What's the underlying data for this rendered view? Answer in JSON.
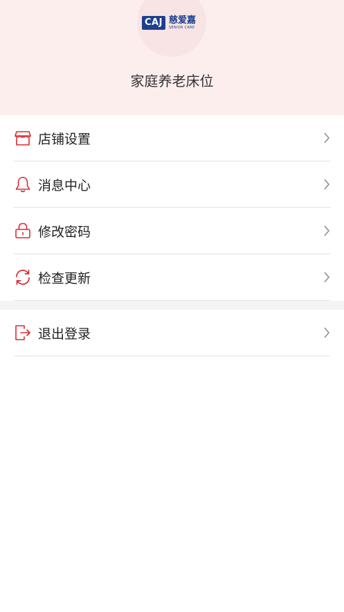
{
  "brand": {
    "logo_abbrev": "CAJ",
    "logo_name_cn": "慈爱嘉",
    "logo_name_en": "SENIOR CARE"
  },
  "store_name": "家庭养老床位",
  "colors": {
    "header_bg": "#fdeeee",
    "icon_red": "#e0282e",
    "logo_blue": "#1d3f8f",
    "divider": "#e2e2e2"
  },
  "menu": [
    {
      "label": "店铺设置",
      "icon": "store-icon"
    },
    {
      "label": "消息中心",
      "icon": "bell-icon"
    },
    {
      "label": "修改密码",
      "icon": "lock-icon"
    },
    {
      "label": "检查更新",
      "icon": "refresh-icon"
    }
  ],
  "menu_secondary": [
    {
      "label": "退出登录",
      "icon": "logout-icon"
    }
  ]
}
